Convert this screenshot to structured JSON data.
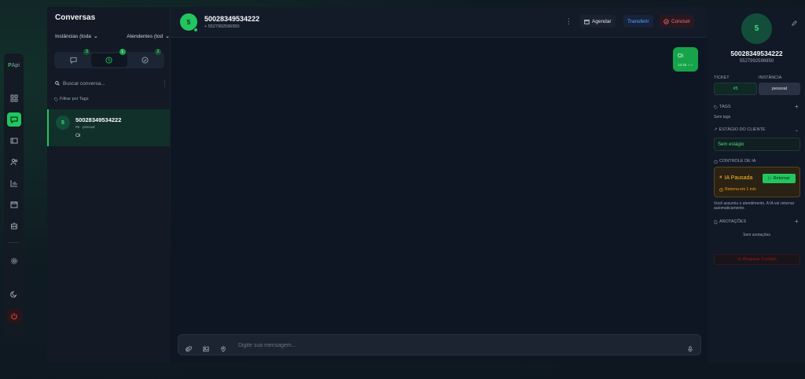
{
  "rail": {
    "logo": "PApi",
    "logo_main": "P",
    "logo_rest": "Api",
    "items": [
      {
        "name": "dashboard",
        "icon": "dashboard-icon"
      },
      {
        "name": "chat",
        "icon": "chat-icon",
        "active": true
      },
      {
        "name": "contacts",
        "icon": "contacts-card-icon"
      },
      {
        "name": "users",
        "icon": "users-icon"
      },
      {
        "name": "reports",
        "icon": "bar-chart-icon"
      },
      {
        "name": "calendar",
        "icon": "calendar-icon"
      },
      {
        "name": "bot",
        "icon": "bot-icon"
      },
      {
        "name": "settings",
        "icon": "gear-icon"
      },
      {
        "name": "theme",
        "icon": "moon-icon"
      },
      {
        "name": "logout",
        "icon": "power-icon"
      }
    ]
  },
  "conversations": {
    "title": "Conversas",
    "filter_instances": "Instâncias (toda",
    "filter_agents": "Atendentes (tod",
    "tabs": [
      {
        "name": "open",
        "icon": "message-square-icon",
        "count": "3"
      },
      {
        "name": "waiting",
        "icon": "clock-icon",
        "count": "1",
        "active": true
      },
      {
        "name": "done",
        "icon": "check-circle-icon",
        "count": "2"
      }
    ],
    "search_placeholder": "Buscar conversa...",
    "tag_filter": "Filtrar por Tags",
    "items": [
      {
        "avatar": "5",
        "name": "50028349534222",
        "sub": "#6 · pessoal",
        "last_message": "Oi"
      }
    ]
  },
  "chat": {
    "avatar": "5",
    "name": "50028349534222",
    "phone": "+ 5527992596950",
    "buttons": {
      "schedule": "Agendar",
      "transfer": "Transferir",
      "finish": "Concluir"
    },
    "messages": [
      {
        "text": "Oi",
        "time": "13:45",
        "ticks": "✓✓"
      }
    ],
    "composer_placeholder": "Digite sua mensagem..."
  },
  "details": {
    "avatar": "5",
    "name": "50028349534222",
    "phone": "5527992596950",
    "ticket_label": "TICKET",
    "ticket_value": "#5",
    "instance_label": "INSTÂNCIA",
    "instance_value": "pessoal",
    "tags_label": "TAGS",
    "tags_empty": "Sem tags",
    "stage_label": "ESTÁGIO DO CLIENTE",
    "stage_value": "Sem estágio",
    "ai_label": "CONTROLE DE IA",
    "ai_status": "IA Pausada",
    "ai_resume": "Retomar",
    "ai_return": "Retorna em 1 min",
    "ai_note": "Você assumiu o atendimento. A IA vai retornar automaticamente.",
    "notes_label": "ANOTAÇÕES",
    "notes_empty": "Sem anotações",
    "block_label": "Bloquear Contato"
  },
  "colors": {
    "accent": "#22c55e",
    "background": "#0f1623",
    "warning": "#f59e0b",
    "danger": "#ef4444",
    "link": "#60a5fa"
  }
}
